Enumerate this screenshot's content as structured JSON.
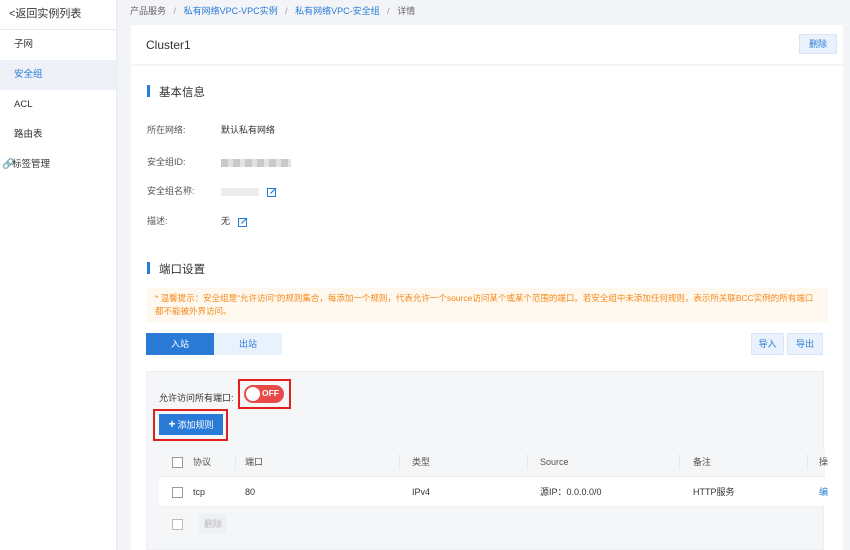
{
  "sidebar": {
    "back_label": "<返回实例列表",
    "items": [
      {
        "label": "子网"
      },
      {
        "label": "安全组"
      },
      {
        "label": "ACL"
      },
      {
        "label": "路由表"
      },
      {
        "label": "标签管理"
      }
    ]
  },
  "breadcrumb": {
    "root": "产品服务",
    "level1": "私有网络VPC-VPC实例",
    "level2": "私有网络VPC-安全组",
    "current": "详情",
    "separator": "/"
  },
  "header": {
    "title": "Cluster1",
    "delete_label": "删除"
  },
  "basic_info": {
    "section_title": "基本信息",
    "network_label": "所在网络:",
    "network_value": "默认私有网络",
    "id_label": "安全组ID:",
    "name_label": "安全组名称:",
    "desc_label": "描述:",
    "desc_value": "无"
  },
  "ports": {
    "section_title": "端口设置",
    "tip": "* 温馨提示：安全组是“允许访问”的规则集合，每添加一个规则，代表允许一个source访问某个或某个范围的端口。若安全组中未添加任何规则，表示所关联BCC实例的所有端口都不能被外界访问。",
    "tabs": [
      {
        "label": "入站"
      },
      {
        "label": "出站"
      }
    ],
    "import_label": "导入",
    "export_label": "导出",
    "allow_all_label": "允许访问所有端口:",
    "toggle_text": "OFF",
    "add_rule_label": "添加规则",
    "table": {
      "headers": {
        "protocol": "协议",
        "port": "端口",
        "type": "类型",
        "source": "Source",
        "note": "备注",
        "op": "操"
      },
      "rows": [
        {
          "protocol": "tcp",
          "port": "80",
          "type": "IPv4",
          "source": "源IP：0.0.0.0/0",
          "note": "HTTP服务",
          "op": "编"
        }
      ]
    },
    "bulk_delete_label": "删除"
  },
  "colors": {
    "accent": "#2a7bd8",
    "toggle_off": "#e84a4a",
    "highlight": "#e02020",
    "tip_text": "#f5891a"
  }
}
